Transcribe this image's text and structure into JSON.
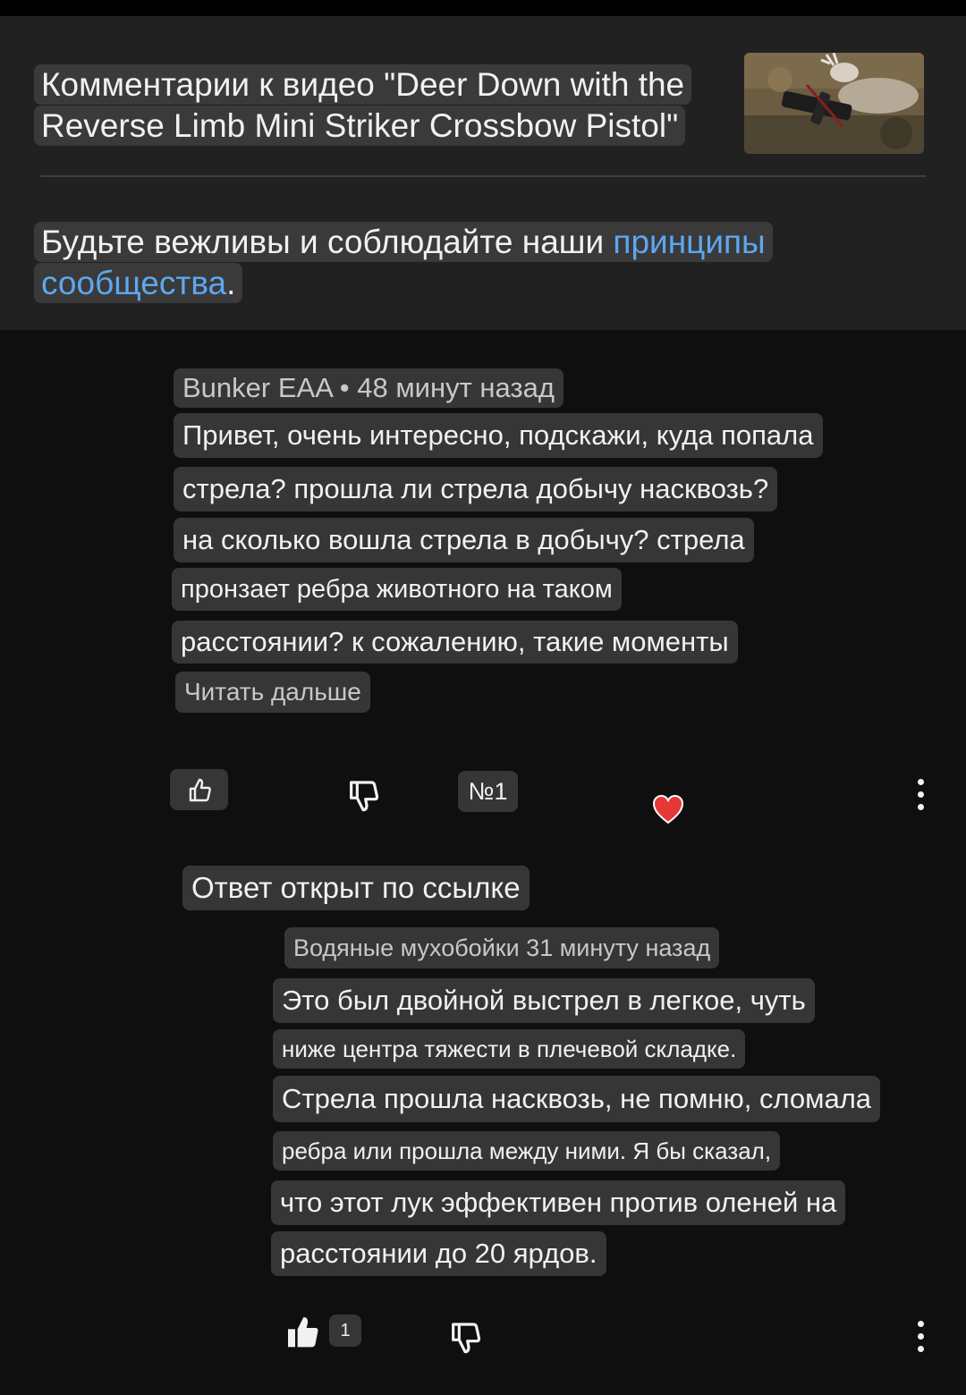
{
  "header": {
    "title": "Комментарии к видео \"Deer Down with the Reverse Limb Mini Striker Crossbow Pistol\"",
    "rules_prefix": "Будьте вежливы и соблюдайте наши ",
    "rules_link": "принципы сообщества",
    "rules_suffix": "."
  },
  "comment": {
    "author": "Bunker EAA",
    "separator": "•",
    "time": "48 минут назад",
    "lines": [
      "Привет, очень интересно, подскажи, куда попала",
      "стрела? прошла ли стрела добычу насквозь?",
      "на сколько вошла стрела в добычу? стрела",
      "пронзает ребра животного на таком",
      "расстоянии? к сожалению, такие моменты"
    ],
    "read_more": "Читать дальше",
    "number_badge": "№1"
  },
  "reply_note": "Ответ открыт по ссылке",
  "reply": {
    "author_time": "Водяные мухобойки 31 минуту назад",
    "lines": [
      "Это был двойной выстрел в легкое, чуть",
      "ниже центра тяжести в плечевой складке.",
      "Стрела прошла насквозь, не помню, сломала",
      "ребра или прошла между ними. Я бы сказал,",
      "что этот лук эффективен против оленей на",
      "расстоянии до 20 ярдов."
    ],
    "like_count": "1"
  },
  "icons": {
    "thumbnail": "deer-crossbow-thumbnail",
    "like": "thumb-up-icon",
    "dislike": "thumb-down-icon",
    "heart": "heart-icon",
    "more": "more-vert-icon"
  },
  "colors": {
    "background": "#0f0f0f",
    "header_bg": "#212121",
    "highlight": "#363636",
    "link": "#5ea7f0",
    "heart": "#e53935"
  }
}
